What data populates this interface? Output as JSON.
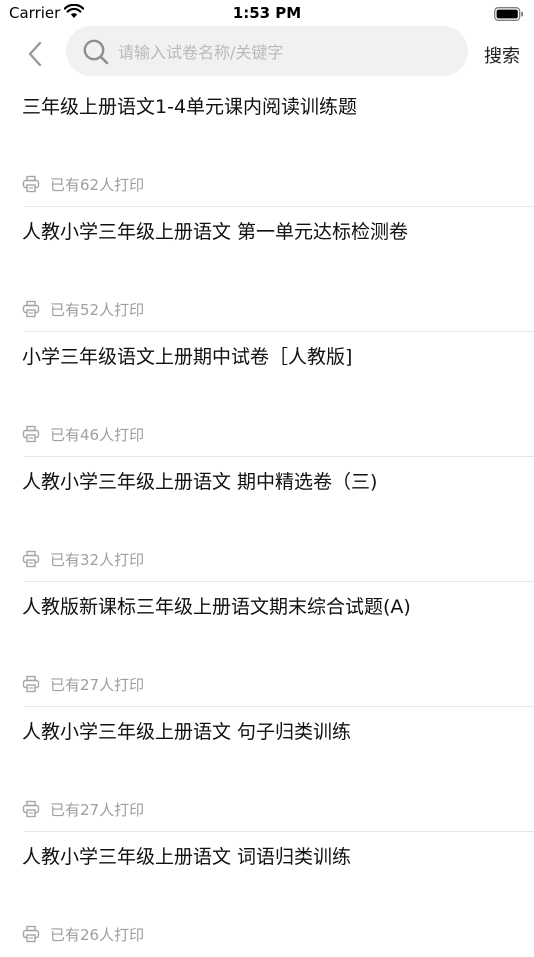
{
  "status": {
    "carrier": "Carrier",
    "time": "1:53 PM"
  },
  "nav": {
    "search_placeholder": "请输入试卷名称/关键字",
    "search_label": "搜索"
  },
  "items": [
    {
      "title": "三年级上册语文1-4单元课内阅读训练题",
      "prints": "已有62人打印"
    },
    {
      "title": "人教小学三年级上册语文 第一单元达标检测卷",
      "prints": "已有52人打印"
    },
    {
      "title": "小学三年级语文上册期中试卷［人教版]",
      "prints": "已有46人打印"
    },
    {
      "title": "人教小学三年级上册语文 期中精选卷（三)",
      "prints": "已有32人打印"
    },
    {
      "title": "人教版新课标三年级上册语文期末综合试题(A)",
      "prints": "已有27人打印"
    },
    {
      "title": "人教小学三年级上册语文 句子归类训练",
      "prints": "已有27人打印"
    },
    {
      "title": "人教小学三年级上册语文 词语归类训练",
      "prints": "已有26人打印"
    }
  ]
}
